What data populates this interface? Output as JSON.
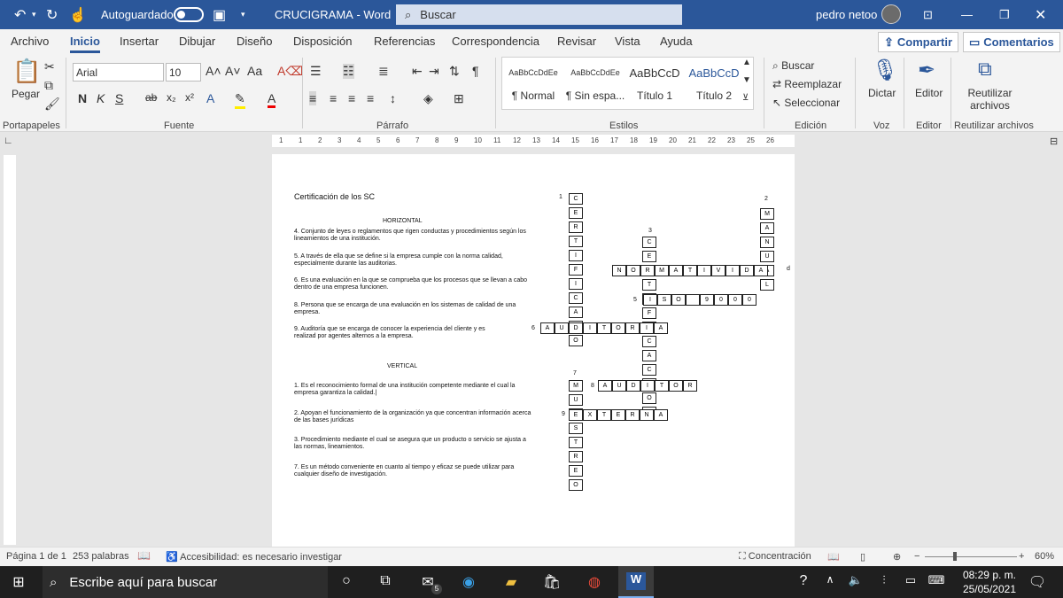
{
  "titlebar": {
    "autosave": "Autoguardado",
    "doc_title": "CRUCIGRAMA",
    "app": "Word",
    "search": "Buscar",
    "user": "pedro netoo"
  },
  "menu": {
    "tabs": [
      "Archivo",
      "Inicio",
      "Insertar",
      "Dibujar",
      "Diseño",
      "Disposición",
      "Referencias",
      "Correspondencia",
      "Revisar",
      "Vista",
      "Ayuda"
    ],
    "share": "Compartir",
    "comments": "Comentarios"
  },
  "ribbon": {
    "paste": "Pegar",
    "font": "Arial",
    "size": "10",
    "style_previews": [
      "AaBbCcDdEe",
      "AaBbCcDdEe",
      "AaBbCcD",
      "AaBbCcD"
    ],
    "styles": [
      "¶ Normal",
      "¶ Sin espa...",
      "Título 1",
      "Título 2"
    ],
    "find": "Buscar",
    "replace": "Reemplazar",
    "select": "Seleccionar",
    "dictate": "Dictar",
    "editor": "Editor",
    "reuse": "Reutilizar archivos",
    "groups": [
      "Portapapeles",
      "Fuente",
      "Párrafo",
      "Estilos",
      "Edición",
      "Voz",
      "Editor",
      "Reutilizar archivos"
    ]
  },
  "ruler": [
    "1",
    "1",
    "2",
    "3",
    "4",
    "5",
    "6",
    "7",
    "8",
    "9",
    "10",
    "11",
    "12",
    "13",
    "14",
    "15",
    "16",
    "17",
    "18",
    "19",
    "20",
    "21",
    "22",
    "23",
    "25",
    "26"
  ],
  "document": {
    "title": "Certificación de los SC",
    "horizontal_head": "HORIZONTAL",
    "horizontal": [
      "4. Conjunto de leyes o reglamentos que rigen conductas y procedimientos según los lineamientos de una institución.",
      "5. A través de ella que se define si la empresa cumple con la norma calidad, especialmente durante las auditorias.",
      "6. Es una evaluación en la que se comprueba que los procesos que se llevan a cabo dentro de una empresa funcionen.",
      "8. Persona que se encarga de una evaluación en los sistemas de calidad de una empresa.",
      "9. Auditoría que se encarga de conocer la experiencia del cliente y es realizad por agentes alternos a la empresa."
    ],
    "vertical_head": "VERTICAL",
    "vertical": [
      "1.   Es el reconocimiento formal de una institución competente mediante el cual la empresa garantiza la calidad.|",
      "2.   Apoyan el funcionamiento de la organización ya que concentran información acerca de las bases jurídicas",
      "3.   Procedimiento mediante el cual se asegura que un producto o servicio se ajusta a las normas, lineamientos.",
      "7. Es un método conveniente en cuanto al tiempo y eficaz se puede utilizar para cualquier diseño de investigación."
    ],
    "numbers": [
      "1",
      "2",
      "3",
      "4",
      "5",
      "6",
      "7",
      "8",
      "9"
    ],
    "overflow_letter": "d"
  },
  "crossword": {
    "w1": [
      "C",
      "E",
      "R",
      "T",
      "I",
      "F",
      "I",
      "C",
      "A",
      "D",
      "O"
    ],
    "w2": [
      "M",
      "A",
      "N",
      "U",
      "A",
      "L"
    ],
    "w3": [
      "C",
      "E",
      "R",
      "T",
      "I",
      "F",
      "I",
      "C",
      "A",
      "C",
      "I",
      "O",
      "N"
    ],
    "w4": [
      "N",
      "O",
      "R",
      "M",
      "A",
      "T",
      "I",
      "V",
      "I",
      "D",
      "A"
    ],
    "w5": [
      "I",
      "S",
      "O",
      "",
      "9",
      "0",
      "0",
      "0"
    ],
    "w6": [
      "A",
      "U",
      "D",
      "I",
      "T",
      "O",
      "R",
      "I",
      "A"
    ],
    "w7": [
      "M",
      "U",
      "E",
      "S",
      "T",
      "R",
      "E",
      "O"
    ],
    "w8": [
      "A",
      "U",
      "D",
      "I",
      "T",
      "O",
      "R"
    ],
    "w9": [
      "E",
      "X",
      "T",
      "E",
      "R",
      "N",
      "A"
    ]
  },
  "status": {
    "page": "Página 1 de 1",
    "words": "253 palabras",
    "access": "Accesibilidad: es necesario investigar",
    "focus": "Concentración",
    "zoom": "60%"
  },
  "taskbar": {
    "search": "Escribe aquí para buscar",
    "time": "08:29 p. m.",
    "date": "25/05/2021",
    "mail_badge": "5"
  }
}
